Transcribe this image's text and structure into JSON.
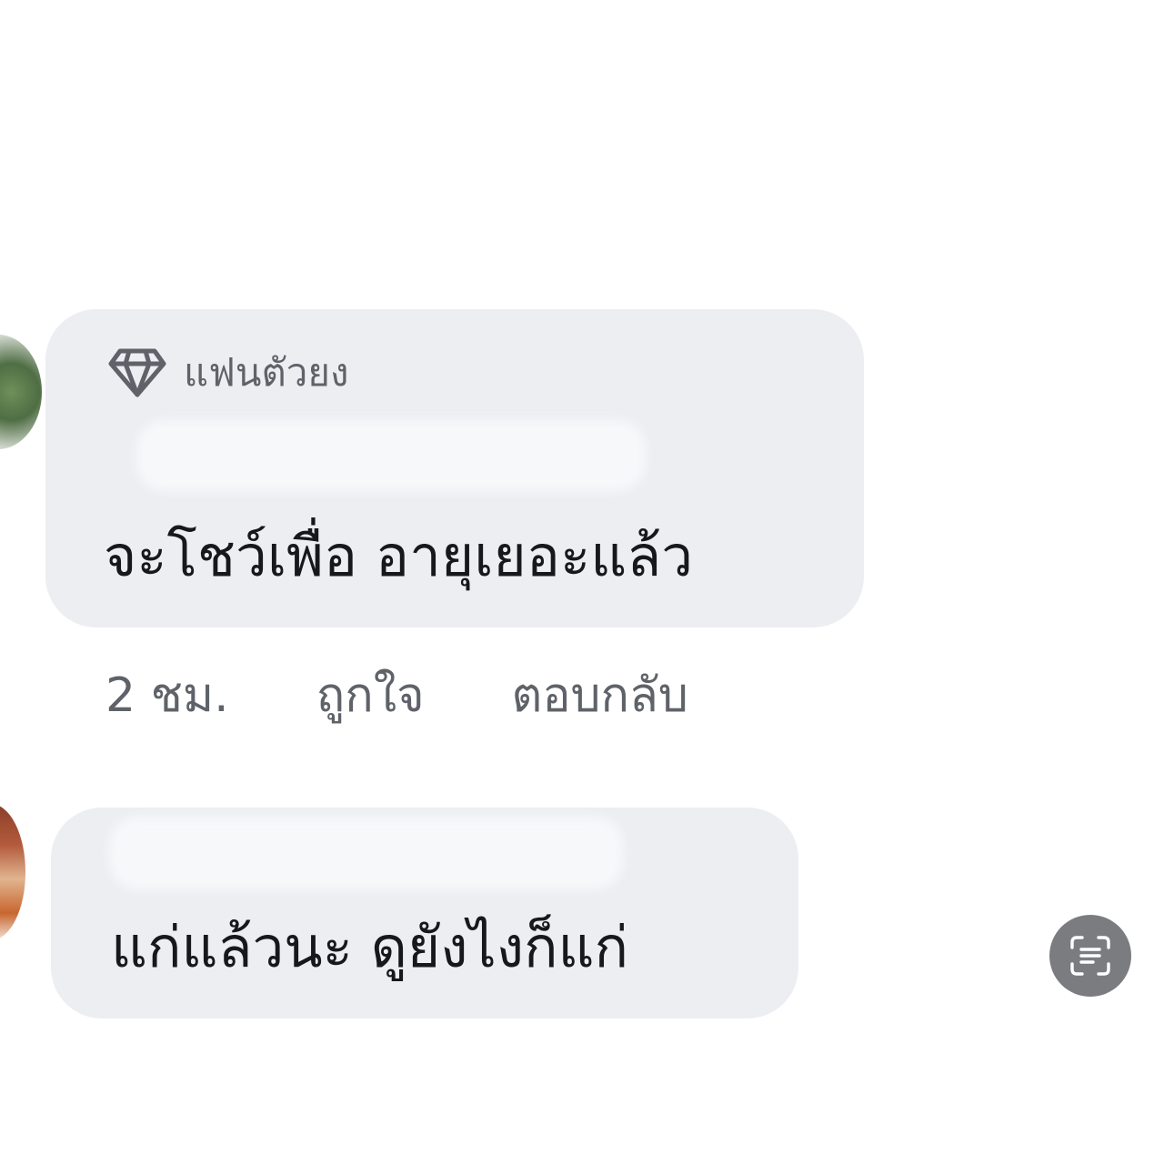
{
  "comments": [
    {
      "badge": {
        "icon": "diamond-icon",
        "label": "แฟนตัวยง"
      },
      "text": "จะโชว์เพื่อ อายุเยอะแล้ว",
      "meta": {
        "time": "2 ชม.",
        "like_label": "ถูกใจ",
        "reply_label": "ตอบกลับ"
      }
    },
    {
      "text": "แก่แล้วนะ  ดูยังไงก็แก่"
    }
  ],
  "scan_button": {
    "icon": "text-scan-icon"
  },
  "colors": {
    "bubble": "#eceef2",
    "text": "#16181b",
    "meta": "#5f6369",
    "scan_button": "#7b7c80"
  }
}
